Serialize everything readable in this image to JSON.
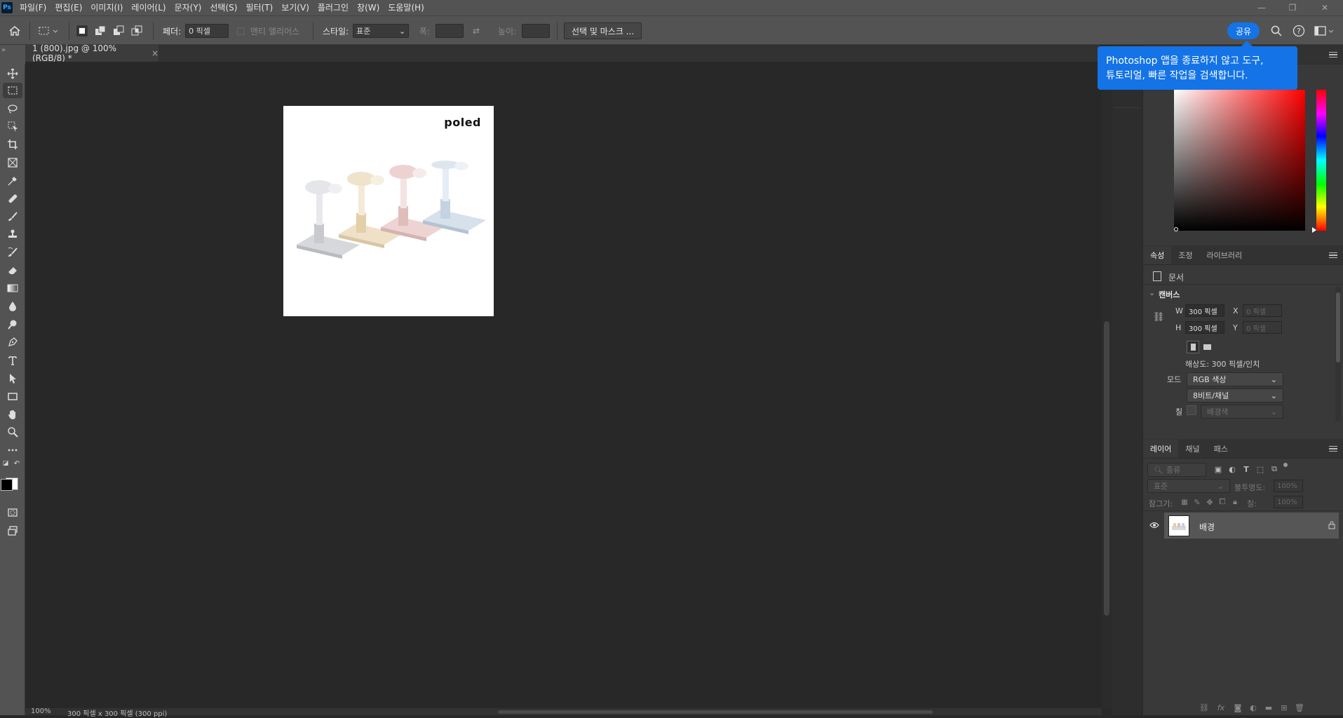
{
  "menubar": {
    "logo": "Ps",
    "items": [
      "파일(F)",
      "편집(E)",
      "이미지(I)",
      "레이어(L)",
      "문자(Y)",
      "선택(S)",
      "필터(T)",
      "보기(V)",
      "플러그인",
      "창(W)",
      "도움말(H)"
    ]
  },
  "options": {
    "feather_label": "페더:",
    "feather_value": "0 픽셀",
    "antialias_label": "앤티 앨리어스",
    "style_label": "스타일:",
    "style_value": "표준",
    "width_label": "폭:",
    "height_label": "높이:",
    "select_mask_button": "선택 및 마스크 ...",
    "share_button": "공유"
  },
  "document_tab": {
    "title": "1 (800).jpg @ 100% (RGB/8) *",
    "close": "×"
  },
  "document": {
    "brand_logo": "poled"
  },
  "tooltip": {
    "line1": "Photoshop 앱을 종료하지 않고 도구,",
    "line2": "튜토리얼, 빠른 작업을 검색합니다."
  },
  "properties": {
    "tabs": [
      "속성",
      "조정",
      "라이브러리"
    ],
    "doc_label": "문서",
    "section": "캔버스",
    "w_label": "W",
    "w_value": "300 픽셀",
    "h_label": "H",
    "h_value": "300 픽셀",
    "x_label": "X",
    "x_value": "0 픽셀",
    "y_label": "Y",
    "y_value": "0 픽셀",
    "resolution": "해상도: 300 픽셀/인치",
    "mode_label": "모드",
    "mode_value": "RGB 색상",
    "bitdepth_value": "8비트/채널",
    "fill_label": "칠",
    "fill_value": "배경색"
  },
  "layers": {
    "tabs": [
      "레이어",
      "채널",
      "패스"
    ],
    "filter_placeholder": "종류",
    "blend_mode": "표준",
    "opacity_label": "불투명도:",
    "opacity_value": "100%",
    "lock_label": "잠그기:",
    "fill_label": "칠:",
    "fill_value": "100%",
    "layer_name": "배경"
  },
  "status": {
    "zoom": "100%",
    "info": "300 픽셀 x 300 픽셀 (300 ppi)"
  },
  "colors": {
    "accent": "#1473e6",
    "foreground": "#000000",
    "background": "#ffffff",
    "picker_hue": "#ff0000"
  }
}
